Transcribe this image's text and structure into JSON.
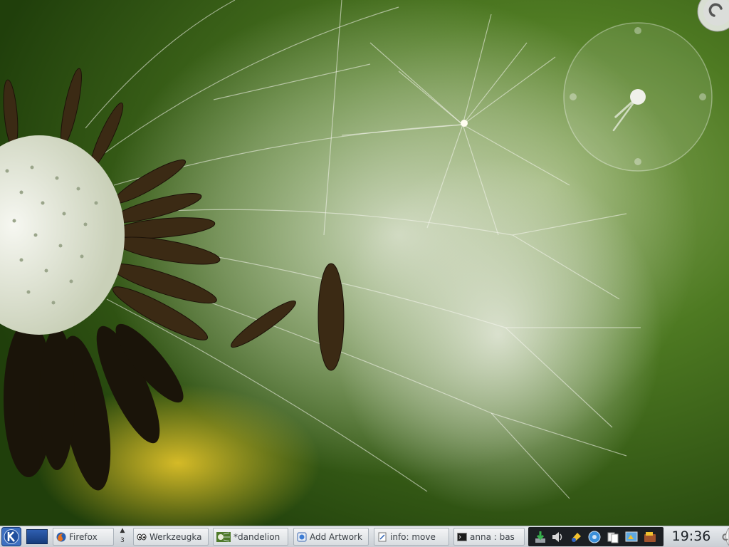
{
  "desktop": {
    "wallpaper": "dandelion-seed-head-macro",
    "widgets": {
      "analog_clock": {
        "hour": 19,
        "minute": 36
      },
      "cashew": {
        "icon": "plasma-cashew-icon"
      }
    }
  },
  "panel": {
    "launcher": {
      "icon": "kde-k-menu-icon"
    },
    "show_desktop": {
      "icon": "show-desktop-icon"
    },
    "pager": {
      "arrow": "▲",
      "desktop_number": "3"
    },
    "tasks": [
      {
        "label": "Firefox",
        "icon": "firefox-icon"
      },
      {
        "label": "Werkzeugka",
        "icon": "eye-icon"
      },
      {
        "label": "*dandelion",
        "icon": "image-thumbnail-icon"
      },
      {
        "label": "Add Artwork",
        "icon": "konqueror-icon"
      },
      {
        "label": "info: move",
        "icon": "document-icon"
      },
      {
        "label": "anna : bas",
        "icon": "terminal-icon"
      }
    ],
    "tray": {
      "icons": [
        "download-icon",
        "volume-icon",
        "klipper-icon",
        "help-icon",
        "clipboard-icon",
        "display-icon",
        "wallet-icon"
      ]
    },
    "clock": "19:36"
  }
}
